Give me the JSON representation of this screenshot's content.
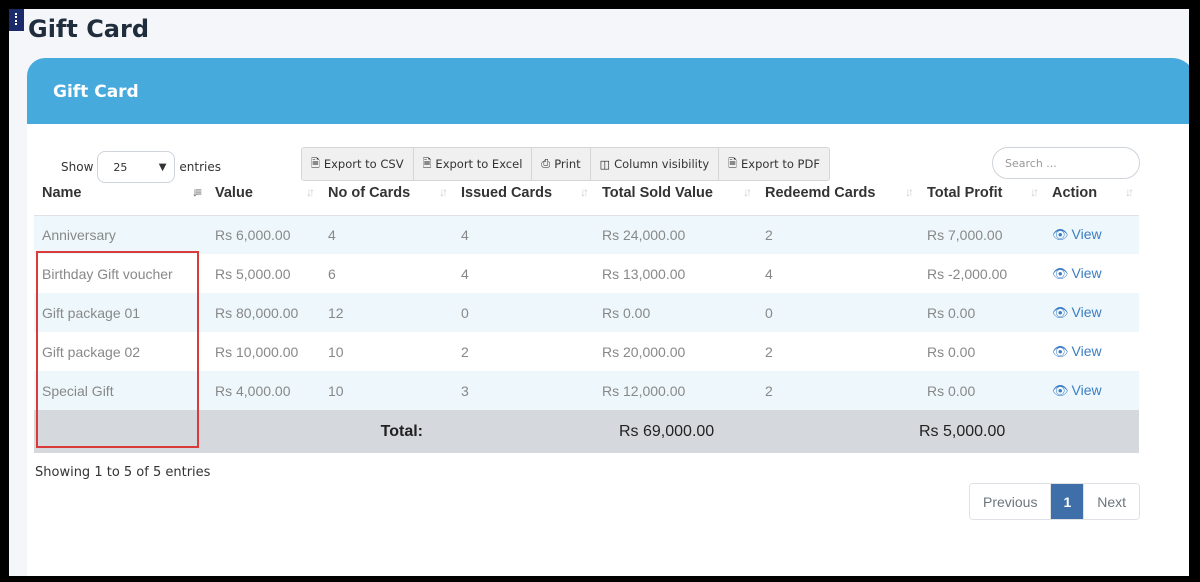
{
  "page": {
    "title": "Gift Card"
  },
  "card": {
    "header": "Gift Card"
  },
  "length": {
    "show": "Show",
    "value": "25",
    "entries": "entries"
  },
  "buttons": [
    {
      "label": "Export to CSV",
      "icon": "csv-file-icon"
    },
    {
      "label": "Export to Excel",
      "icon": "excel-file-icon"
    },
    {
      "label": "Print",
      "icon": "print-icon"
    },
    {
      "label": "Column visibility",
      "icon": "columns-icon"
    },
    {
      "label": "Export to PDF",
      "icon": "pdf-file-icon"
    }
  ],
  "search": {
    "placeholder": "Search ..."
  },
  "table": {
    "columns": [
      "Name",
      "Value",
      "No of Cards",
      "Issued Cards",
      "Total Sold Value",
      "Redeemd Cards",
      "Total Profit",
      "Action"
    ],
    "rows": [
      [
        "Anniversary",
        "Rs 6,000.00",
        "4",
        "4",
        "Rs 24,000.00",
        "2",
        "Rs 7,000.00",
        "View"
      ],
      [
        "Birthday Gift voucher",
        "Rs 5,000.00",
        "6",
        "4",
        "Rs 13,000.00",
        "4",
        "Rs -2,000.00",
        "View"
      ],
      [
        "Gift package 01",
        "Rs 80,000.00",
        "12",
        "0",
        "Rs 0.00",
        "0",
        "Rs 0.00",
        "View"
      ],
      [
        "Gift package 02",
        "Rs 10,000.00",
        "10",
        "2",
        "Rs 20,000.00",
        "2",
        "Rs 0.00",
        "View"
      ],
      [
        "Special Gift",
        "Rs 4,000.00",
        "10",
        "3",
        "Rs 12,000.00",
        "2",
        "Rs 0.00",
        "View"
      ]
    ],
    "footer": {
      "label": "Total:",
      "sold": "Rs 69,000.00",
      "profit": "Rs 5,000.00"
    }
  },
  "info": "Showing 1 to 5 of 5 entries",
  "pager": {
    "previous": "Previous",
    "current": "1",
    "next": "Next"
  },
  "colors": {
    "header": "#47aadd",
    "highlight": "#d93a3a",
    "link": "#3b7dc4",
    "active_page": "#3e6fa8"
  }
}
